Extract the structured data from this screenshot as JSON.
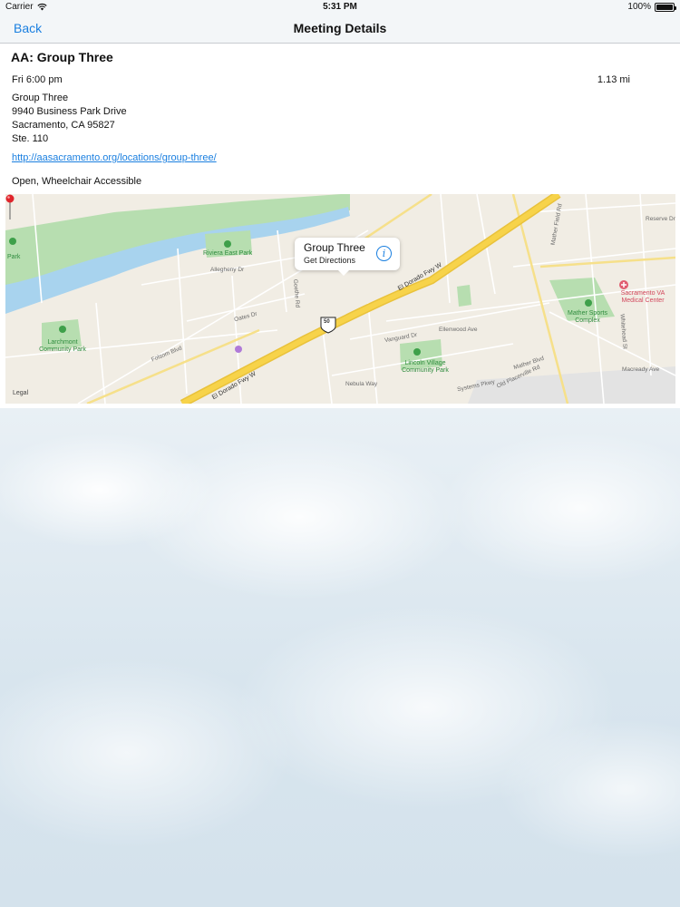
{
  "status": {
    "carrier": "Carrier",
    "time": "5:31 PM",
    "battery": "100%"
  },
  "nav": {
    "back_label": "Back",
    "title": "Meeting Details"
  },
  "meeting": {
    "title": "AA: Group Three",
    "time": "Fri 6:00 pm",
    "distance": "1.13 mi",
    "address_lines": [
      "Group Three",
      "9940 Business Park Drive",
      "Sacramento, CA 95827",
      "Ste. 110"
    ],
    "link": "http://aasacramento.org/locations/group-three/",
    "types": "Open, Wheelchair Accessible"
  },
  "map": {
    "callout_title": "Group Three",
    "callout_subtitle": "Get Directions",
    "legal": "Legal",
    "parks": [
      "Riviera East Park",
      "Larchmont Community Park",
      "Lincoln Village Community Park",
      "Mather Sports Complex",
      "Park"
    ],
    "medical": "Sacramento VA Medical Center",
    "highway_labels": [
      "El Dorado Fwy W",
      "El Dorado Fwy W"
    ],
    "shield": "50",
    "streets": [
      "Folsom Blvd",
      "Mather Field Rd",
      "Ellenwood Ave",
      "Mather Blvd",
      "Macready Ave",
      "Oates Dr",
      "Allegheny Dr",
      "Vanguard Dr",
      "Systems Pkwy",
      "Old Placerville Rd",
      "Whitehead St",
      "Nebula Way",
      "Goethe Rd",
      "Reserve Dr"
    ]
  }
}
